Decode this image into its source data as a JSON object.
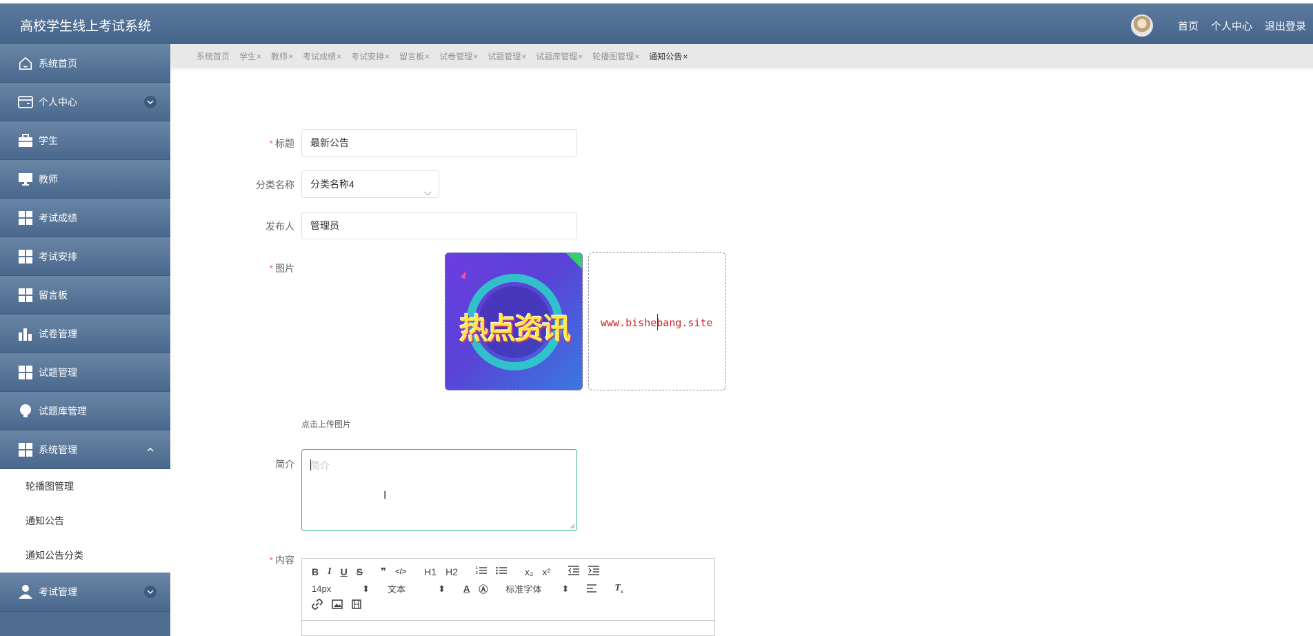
{
  "app": {
    "title": "高校学生线上考试系统"
  },
  "header": {
    "nav": [
      "首页",
      "个人中心",
      "退出登录"
    ]
  },
  "sidebar": {
    "items": [
      {
        "label": "系统首页",
        "icon": "home-icon"
      },
      {
        "label": "个人中心",
        "icon": "card-icon",
        "expandable": true
      },
      {
        "label": "学生",
        "icon": "briefcase-icon"
      },
      {
        "label": "教师",
        "icon": "monitor-icon"
      },
      {
        "label": "考试成绩",
        "icon": "grid-icon"
      },
      {
        "label": "考试安排",
        "icon": "grid-icon"
      },
      {
        "label": "留言板",
        "icon": "grid-icon"
      },
      {
        "label": "试卷管理",
        "icon": "bar-chart-icon"
      },
      {
        "label": "试题管理",
        "icon": "grid-icon"
      },
      {
        "label": "试题库管理",
        "icon": "bulb-icon"
      },
      {
        "label": "系统管理",
        "icon": "grid-icon",
        "expanded": true
      }
    ],
    "sub_items": [
      "轮播图管理",
      "通知公告",
      "通知公告分类"
    ],
    "bottom_item": {
      "label": "考试管理",
      "icon": "user-icon"
    }
  },
  "tabs": [
    {
      "label": "系统首页",
      "closable": false
    },
    {
      "label": "学生",
      "closable": true
    },
    {
      "label": "教师",
      "closable": true
    },
    {
      "label": "考试成绩",
      "closable": true
    },
    {
      "label": "考试安排",
      "closable": true
    },
    {
      "label": "留言板",
      "closable": true
    },
    {
      "label": "试卷管理",
      "closable": true
    },
    {
      "label": "试题管理",
      "closable": true
    },
    {
      "label": "试题库管理",
      "closable": true
    },
    {
      "label": "轮播图管理",
      "closable": true
    },
    {
      "label": "通知公告",
      "closable": true,
      "active": true
    }
  ],
  "form": {
    "title": {
      "label": "标题",
      "required": true,
      "value": "最新公告"
    },
    "category": {
      "label": "分类名称",
      "value": "分类名称4"
    },
    "publisher": {
      "label": "发布人",
      "value": "管理员"
    },
    "image": {
      "label": "图片",
      "required": true,
      "thumb_text": "热点资讯",
      "preview_text": "www.bishebang.site",
      "hint": "点击上传图片"
    },
    "intro": {
      "label": "简介",
      "placeholder": "简介"
    },
    "content": {
      "label": "内容",
      "required": true
    }
  },
  "editor": {
    "row1": [
      "B",
      "I",
      "U",
      "S",
      "❞",
      "</>",
      "H1",
      "H2",
      "ol",
      "ul",
      "x₂",
      "x²",
      "outdent",
      "indent"
    ],
    "font_size": "14px",
    "text_style": "文本",
    "font_family": "标准字体"
  },
  "colors": {
    "header": "#4f6d8f",
    "accent": "#38b48b",
    "required": "#f56c6c"
  }
}
